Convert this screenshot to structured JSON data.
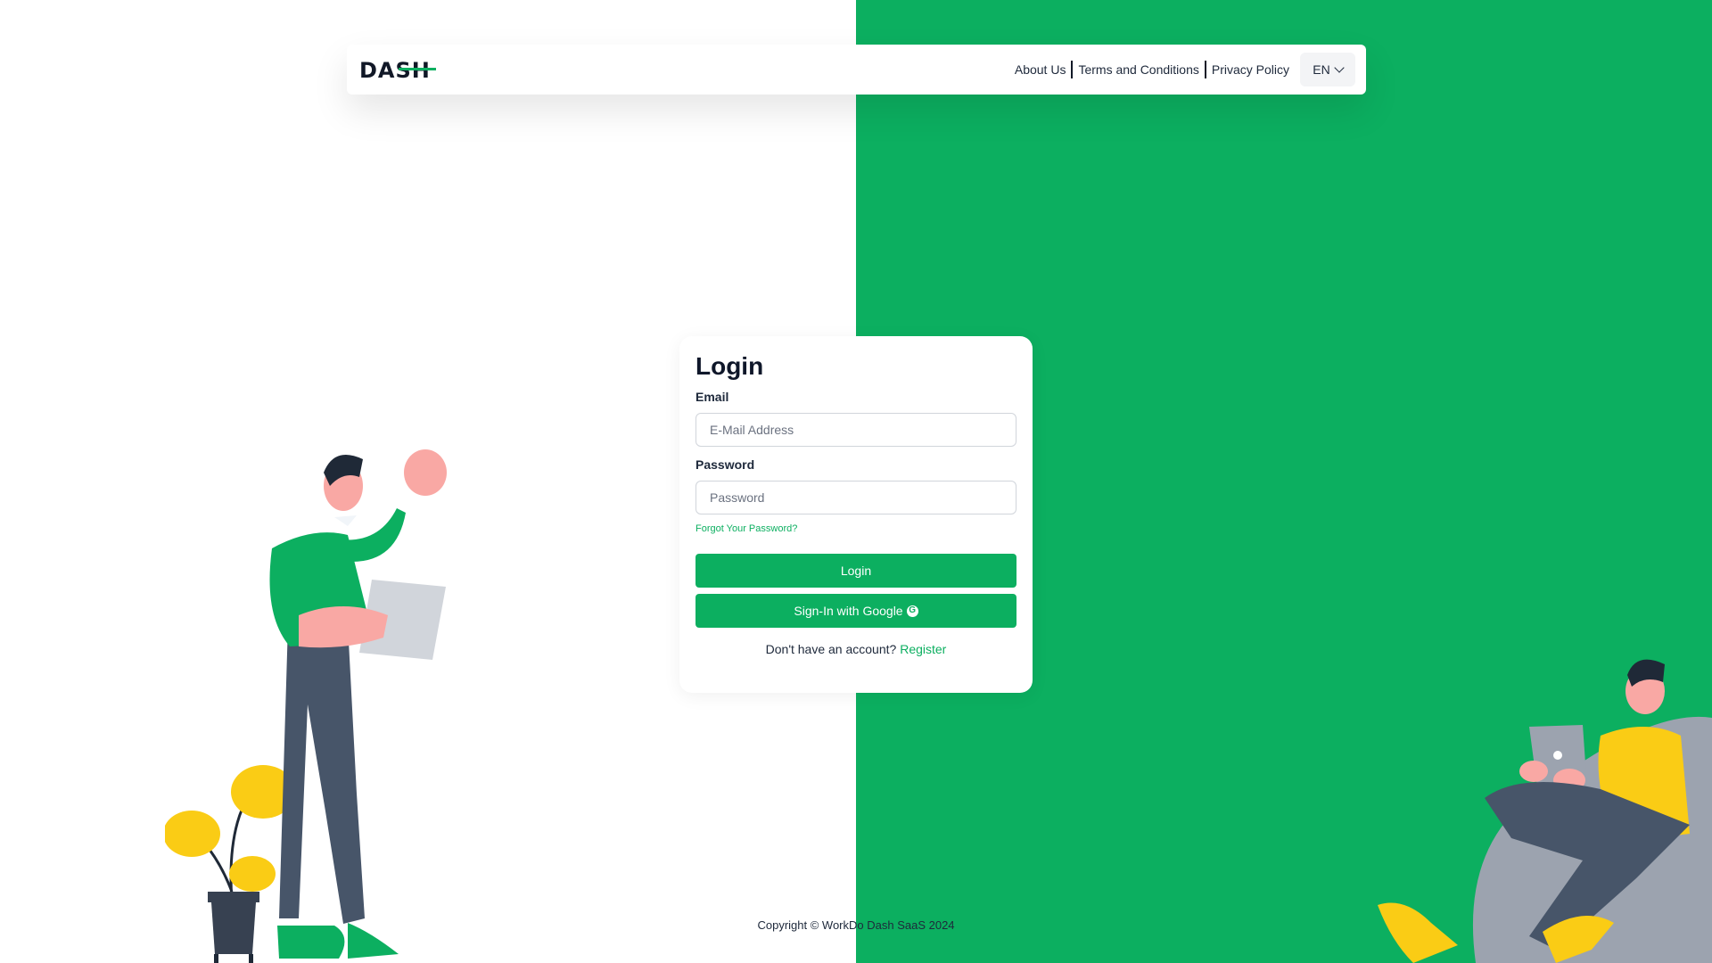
{
  "brand": {
    "logo_text": "DASH",
    "primary_color": "#0caf60"
  },
  "navbar": {
    "links": [
      "About Us",
      "Terms and Conditions",
      "Privacy Policy"
    ],
    "language": "EN"
  },
  "login": {
    "title": "Login",
    "email_label": "Email",
    "email_placeholder": "E-Mail Address",
    "password_label": "Password",
    "password_placeholder": "Password",
    "forgot_link": "Forgot Your Password?",
    "login_button": "Login",
    "google_button": "Sign-In with Google",
    "no_account_text": "Don't have an account?",
    "register_link": "Register"
  },
  "footer": {
    "copyright": "Copyright © WorkDo Dash SaaS 2024"
  }
}
